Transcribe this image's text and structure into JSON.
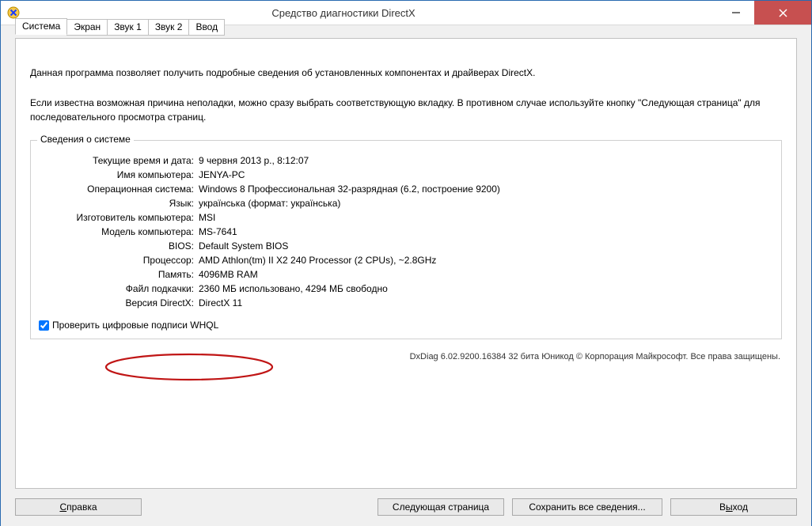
{
  "window": {
    "title": "Средство диагностики DirectX"
  },
  "tabs": {
    "t0": "Система",
    "t1": "Экран",
    "t2": "Звук 1",
    "t3": "Звук 2",
    "t4": "Ввод"
  },
  "intro": {
    "p1": "Данная программа позволяет получить подробные сведения об установленных компонентах и драйверах DirectX.",
    "p2": "Если известна возможная причина неполадки, можно сразу выбрать соответствующую вкладку. В противном случае используйте кнопку \"Следующая страница\" для последовательного просмотра страниц."
  },
  "group": {
    "title": "Сведения о системе",
    "rows": {
      "datetime": {
        "label": "Текущие время и дата:",
        "value": "9 червня 2013 р., 8:12:07"
      },
      "computer": {
        "label": "Имя компьютера:",
        "value": "JENYA-PC"
      },
      "os": {
        "label": "Операционная система:",
        "value": "Windows 8 Профессиональная 32-разрядная (6.2, построение 9200)"
      },
      "lang": {
        "label": "Язык:",
        "value": "українська (формат: українська)"
      },
      "manuf": {
        "label": "Изготовитель компьютера:",
        "value": "MSI"
      },
      "model": {
        "label": "Модель компьютера:",
        "value": "MS-7641"
      },
      "bios": {
        "label": "BIOS:",
        "value": "Default System BIOS"
      },
      "cpu": {
        "label": "Процессор:",
        "value": "AMD Athlon(tm) II X2 240 Processor (2 CPUs), ~2.8GHz"
      },
      "mem": {
        "label": "Память:",
        "value": "4096MB RAM"
      },
      "pagefile": {
        "label": "Файл подкачки:",
        "value": "2360 МБ использовано, 4294 МБ свободно"
      },
      "dxver": {
        "label": "Версия DirectX:",
        "value": "DirectX 11"
      }
    }
  },
  "check": {
    "label": "Проверить цифровые подписи WHQL"
  },
  "footer": "DxDiag 6.02.9200.16384 32 бита Юникод © Корпорация Майкрософт. Все права защищены.",
  "buttons": {
    "help": "Справка",
    "next": "Следующая страница",
    "save": "Сохранить все сведения...",
    "exit": "Выход"
  }
}
